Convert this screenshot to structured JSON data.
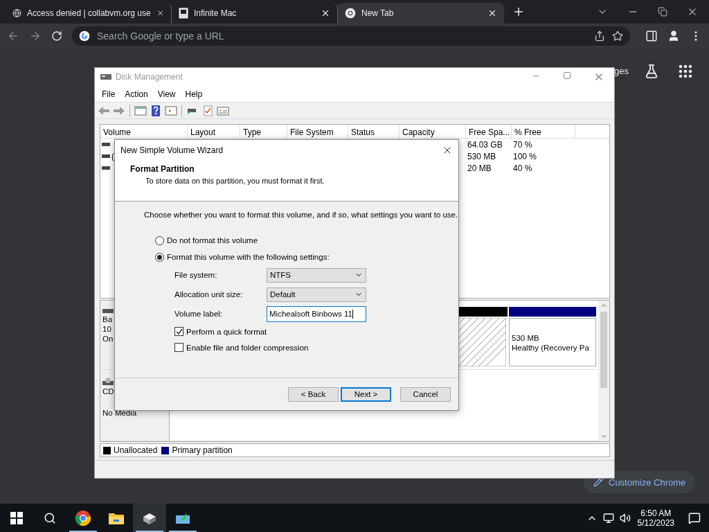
{
  "browser": {
    "tabs": [
      {
        "title": "Access denied | collabvm.org use",
        "kind": "globe",
        "selected": false
      },
      {
        "title": "Infinite Mac",
        "kind": "mac",
        "selected": false
      },
      {
        "title": "New Tab",
        "kind": "chrome",
        "selected": true
      }
    ],
    "omnibox": {
      "placeholder": "Search Google or type a URL"
    },
    "page": {
      "link_fragment": "ges",
      "customize_button": "Customize Chrome"
    }
  },
  "disk_management": {
    "title": "Disk Management",
    "menu": [
      "File",
      "Action",
      "View",
      "Help"
    ],
    "columns": [
      "Volume",
      "Layout",
      "Type",
      "File System",
      "Status",
      "Capacity",
      "Free Spa...",
      "% Free"
    ],
    "rows": [
      {
        "free_space": "64.03 GB",
        "percent_free": "70 %"
      },
      {
        "volume": "(",
        "free_space": "530 MB",
        "percent_free": "100 %"
      },
      {
        "free_space": "20 MB",
        "percent_free": "40 %"
      }
    ],
    "disks": [
      {
        "kind": "disk",
        "label_lines": [
          "Ba",
          "10",
          "On"
        ],
        "partitions": [
          {
            "kind": "unallocated"
          },
          {
            "kind": "primary",
            "size": "530 MB",
            "status": "Healthy (Recovery Pa"
          }
        ]
      },
      {
        "kind": "cdrom",
        "label_lines": [
          "CD"
        ],
        "media": "No Media"
      }
    ],
    "legend": [
      {
        "label": "Unallocated",
        "color": "#000000"
      },
      {
        "label": "Primary partition",
        "color": "#000080"
      }
    ]
  },
  "wizard": {
    "title": "New Simple Volume Wizard",
    "heading": "Format Partition",
    "subheading": "To store data on this partition, you must format it first.",
    "intro": "Choose whether you want to format this volume, and if so, what settings you want to use.",
    "options": [
      {
        "label": "Do not format this volume",
        "selected": false
      },
      {
        "label": "Format this volume with the following settings:",
        "selected": true
      }
    ],
    "settings": [
      {
        "label": "File system:",
        "kind": "dropdown",
        "value": "NTFS"
      },
      {
        "label": "Allocation unit size:",
        "kind": "dropdown",
        "value": "Default"
      },
      {
        "label": "Volume label:",
        "kind": "text",
        "value": "Michealsoft Binbows 11"
      }
    ],
    "checkboxes": [
      {
        "label": "Perform a quick format",
        "checked": true
      },
      {
        "label": "Enable file and folder compression",
        "checked": false
      }
    ],
    "buttons": [
      {
        "label": "< Back",
        "kind": "normal"
      },
      {
        "label": "Next >",
        "kind": "default"
      },
      {
        "label": "Cancel",
        "kind": "normal"
      }
    ]
  },
  "taskbar": {
    "apps": [
      {
        "kind": "chrome",
        "running": true,
        "selected": false
      },
      {
        "kind": "explorer",
        "running": false,
        "selected": false
      },
      {
        "kind": "diskmgmt",
        "running": true,
        "selected": true
      },
      {
        "kind": "setup",
        "running": true,
        "selected": false
      }
    ],
    "time": "6:50 AM",
    "date": "5/12/2023"
  }
}
